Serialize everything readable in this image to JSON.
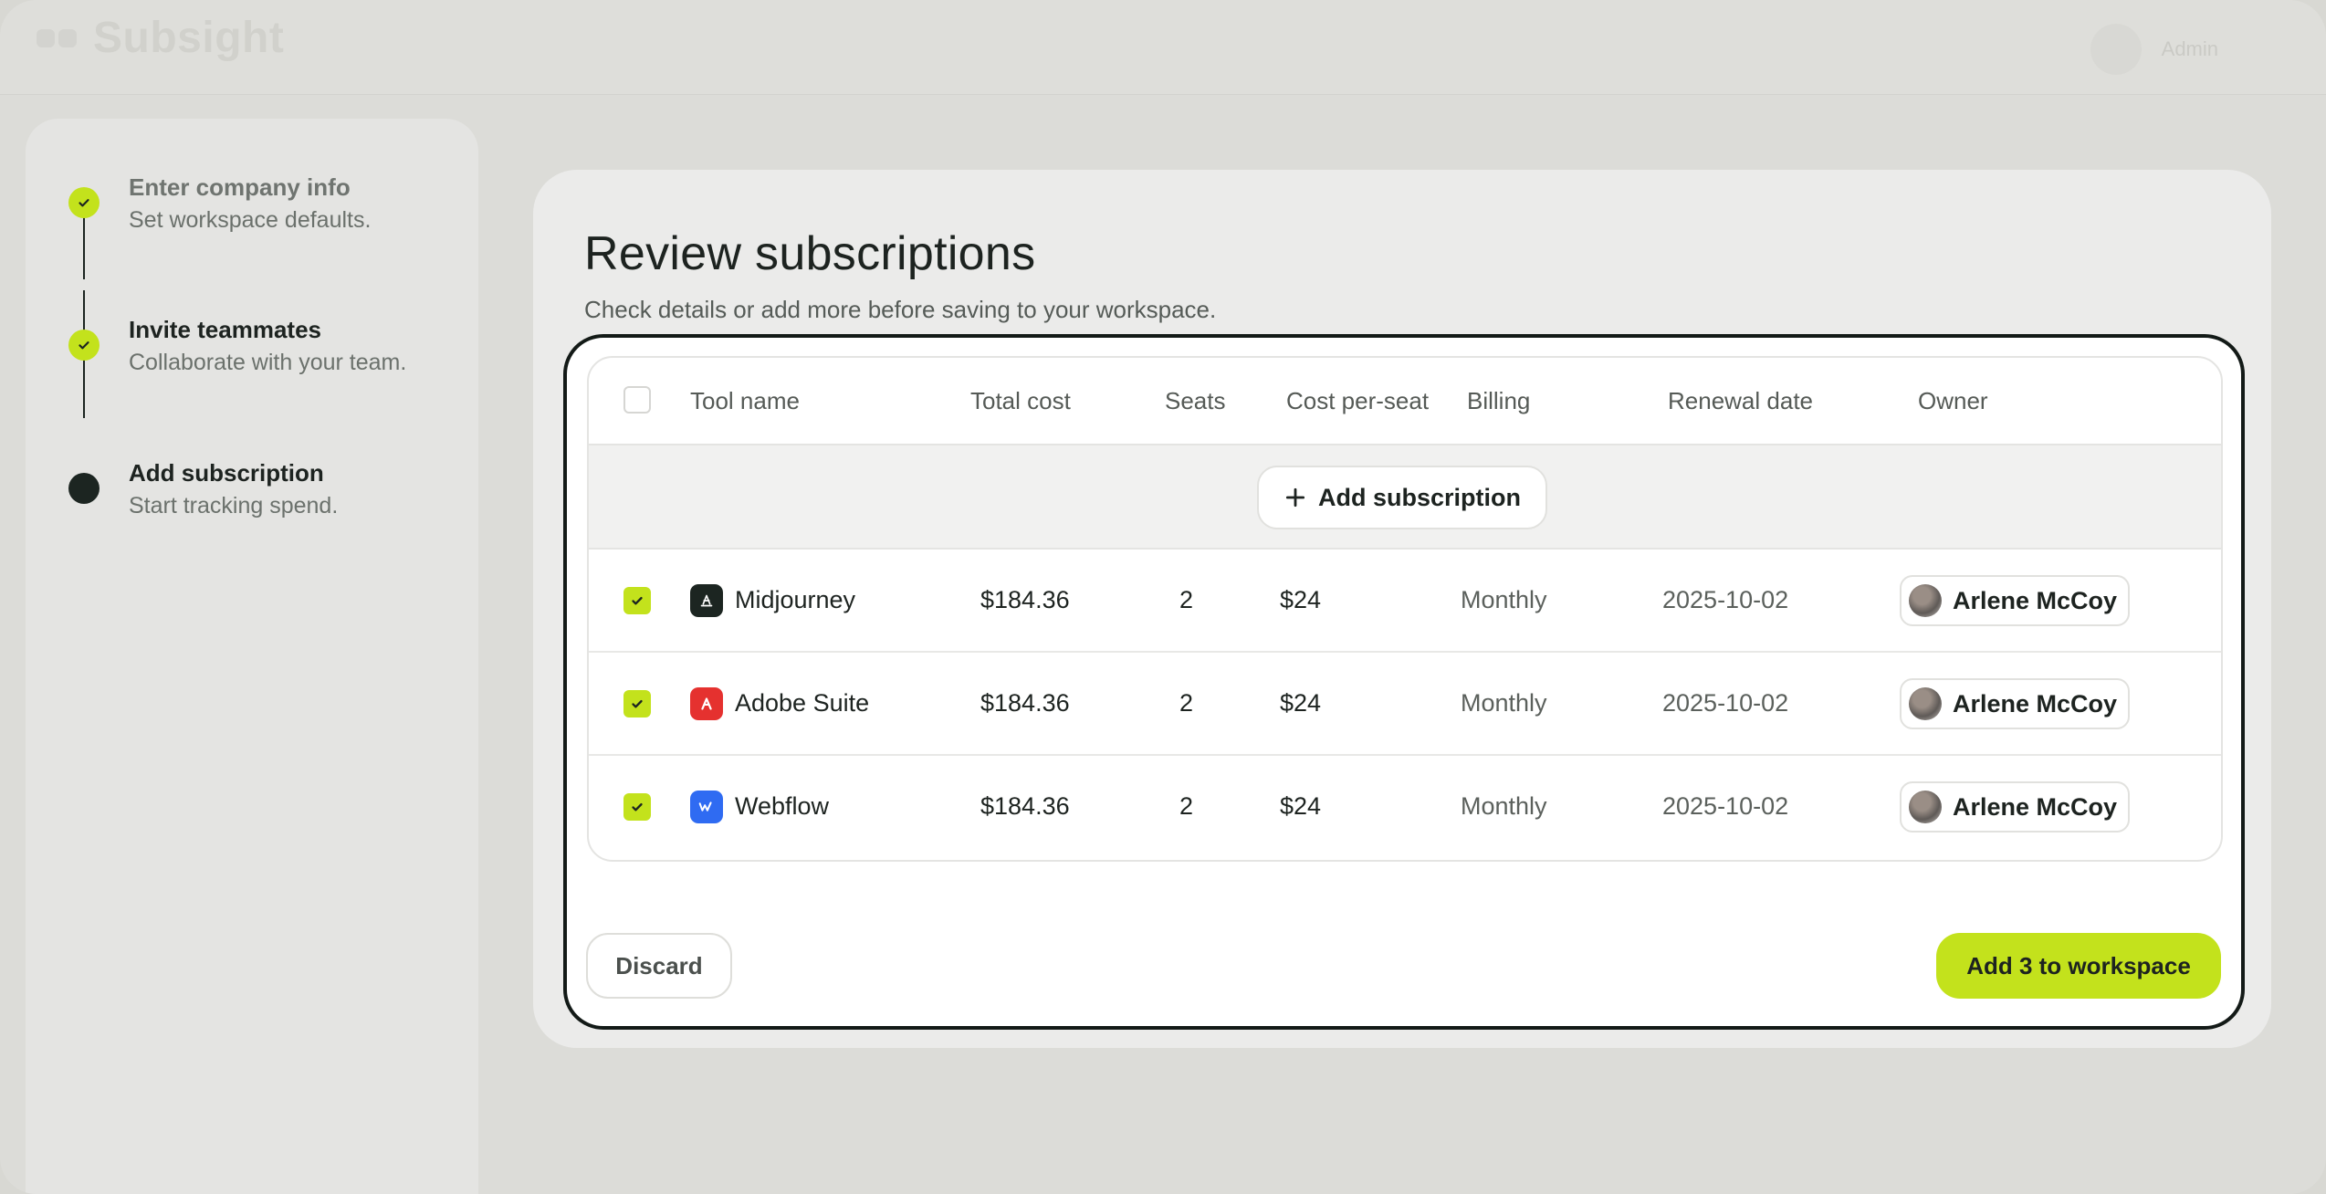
{
  "app": {
    "brand": "Subsight",
    "user_label": "Admin"
  },
  "steps": [
    {
      "title": "Enter company info",
      "subtitle": "Set workspace defaults.",
      "state": "done"
    },
    {
      "title": "Invite teammates",
      "subtitle": "Collaborate with your team.",
      "state": "done"
    },
    {
      "title": "Add subscription",
      "subtitle": "Start tracking spend.",
      "state": "current"
    }
  ],
  "main": {
    "title": "Review subscriptions",
    "subtitle": "Check details or add more before saving to your workspace."
  },
  "table": {
    "columns": [
      "Tool name",
      "Total cost",
      "Seats",
      "Cost per-seat",
      "Billing",
      "Renewal date",
      "Owner"
    ],
    "add_label": "Add subscription",
    "rows": [
      {
        "tool": "Midjourney",
        "icon": "midjourney-icon",
        "total": "$184.36",
        "seats": "2",
        "per_seat": "$24",
        "billing": "Monthly",
        "renewal": "2025-10-02",
        "owner": "Arlene McCoy",
        "checked": true
      },
      {
        "tool": "Adobe Suite",
        "icon": "adobe-icon",
        "total": "$184.36",
        "seats": "2",
        "per_seat": "$24",
        "billing": "Monthly",
        "renewal": "2025-10-02",
        "owner": "Arlene McCoy",
        "checked": true
      },
      {
        "tool": "Webflow",
        "icon": "webflow-icon",
        "total": "$184.36",
        "seats": "2",
        "per_seat": "$24",
        "billing": "Monthly",
        "renewal": "2025-10-02",
        "owner": "Arlene McCoy",
        "checked": true
      }
    ]
  },
  "actions": {
    "discard": "Discard",
    "primary": "Add 3 to workspace"
  },
  "colors": {
    "accent": "#c3e21c",
    "dark": "#1c2521",
    "adobe": "#e5312f",
    "webflow": "#2f6bf2",
    "midjourney": "#1c2521"
  }
}
